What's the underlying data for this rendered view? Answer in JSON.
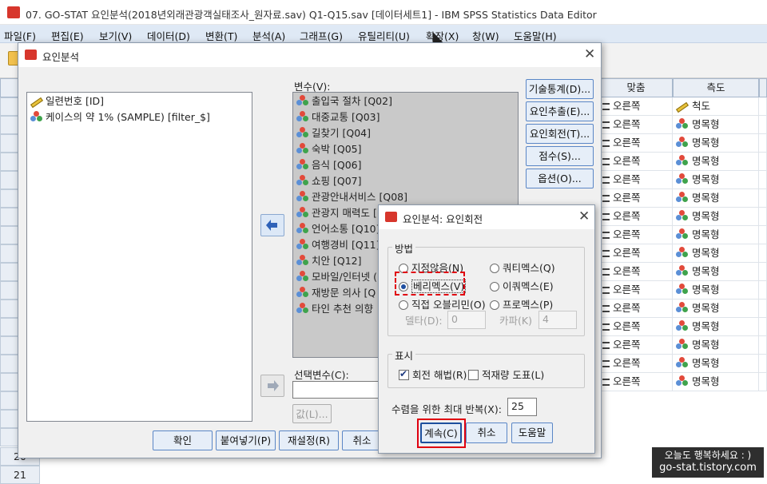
{
  "window": {
    "title": "07. GO-STAT 요인분석(2018년외래관광객실태조사_원자료.sav) Q1-Q15.sav [데이터세트1] - IBM SPSS Statistics Data Editor"
  },
  "menu": [
    "파일(F)",
    "편집(E)",
    "보기(V)",
    "데이터(D)",
    "변환(T)",
    "분석(A)",
    "그래프(G)",
    "유틸리티(U)",
    "확장(X)",
    "창(W)",
    "도움말(H)"
  ],
  "grid": {
    "headers": {
      "align": "맞춤",
      "measure": "측도"
    },
    "rows": [
      {
        "align": "오른쪽",
        "measure": "척도",
        "icon": "ruler-icon"
      },
      {
        "align": "오른쪽",
        "measure": "명목형",
        "icon": "nominal-icon"
      },
      {
        "align": "오른쪽",
        "measure": "명목형",
        "icon": "nominal-icon"
      },
      {
        "align": "오른쪽",
        "measure": "명목형",
        "icon": "nominal-icon"
      },
      {
        "align": "오른쪽",
        "measure": "명목형",
        "icon": "nominal-icon"
      },
      {
        "align": "오른쪽",
        "measure": "명목형",
        "icon": "nominal-icon"
      },
      {
        "align": "오른쪽",
        "measure": "명목형",
        "icon": "nominal-icon"
      },
      {
        "align": "오른쪽",
        "measure": "명목형",
        "icon": "nominal-icon"
      },
      {
        "align": "오른쪽",
        "measure": "명목형",
        "icon": "nominal-icon"
      },
      {
        "align": "오른쪽",
        "measure": "명목형",
        "icon": "nominal-icon"
      },
      {
        "align": "오른쪽",
        "measure": "명목형",
        "icon": "nominal-icon"
      },
      {
        "align": "오른쪽",
        "measure": "명목형",
        "icon": "nominal-icon"
      },
      {
        "align": "오른쪽",
        "measure": "명목형",
        "icon": "nominal-icon"
      },
      {
        "align": "오른쪽",
        "measure": "명목형",
        "icon": "nominal-icon"
      },
      {
        "align": "오른쪽",
        "measure": "명목형",
        "icon": "nominal-icon"
      },
      {
        "align": "오른쪽",
        "measure": "명목형",
        "icon": "nominal-icon"
      }
    ],
    "row_numbers": [
      "20",
      "21"
    ]
  },
  "factor": {
    "title": "요인분석",
    "source_vars": [
      "일련번호 [ID]",
      "케이스의 약 1% (SAMPLE) [filter_$]"
    ],
    "vars_label": "변수(V):",
    "vars": [
      "출입국 절차 [Q02]",
      "대중교통 [Q03]",
      "길찾기 [Q04]",
      "숙박 [Q05]",
      "음식 [Q06]",
      "쇼핑 [Q07]",
      "관광안내서비스 [Q08]",
      "관광지 매력도 [",
      "언어소통 [Q10]",
      "여행경비 [Q11]",
      "치안 [Q12]",
      "모바일/인터넷 (",
      "재방문 의사 [Q",
      "타인 추천 의향"
    ],
    "side_buttons": [
      "기술통계(D)...",
      "요인추출(E)...",
      "요인회전(T)...",
      "점수(S)...",
      "옵션(O)..."
    ],
    "sel_label": "선택변수(C):",
    "value_btn": "값(L)...",
    "bottom_buttons": [
      "확인",
      "붙여넣기(P)",
      "재설정(R)",
      "취소"
    ]
  },
  "rotation": {
    "title": "요인분석: 요인회전",
    "method_label": "방법",
    "options": [
      "지정않음(N)",
      "쿼티멕스(Q)",
      "베리멕스(V)",
      "이쿼멕스(E)",
      "직접 오블리민(O)",
      "프로멕스(P)"
    ],
    "selected": "베리멕스(V)",
    "delta_label": "델타(D):",
    "delta_value": "0",
    "kappa_label": "카파(K)",
    "kappa_value": "4",
    "display_label": "표시",
    "rotated_solution": "회전 해법(R)",
    "loading_plot": "적재량 도표(L)",
    "max_iter_label": "수렴을 위한 최대 반복(X):",
    "max_iter_value": "25",
    "continue_btn": "계속(C)",
    "cancel_btn": "취소",
    "help_btn": "도움말"
  },
  "watermark": {
    "line1": "오늘도 행복하세요 : )",
    "line2": "go-stat.tistory.com"
  }
}
